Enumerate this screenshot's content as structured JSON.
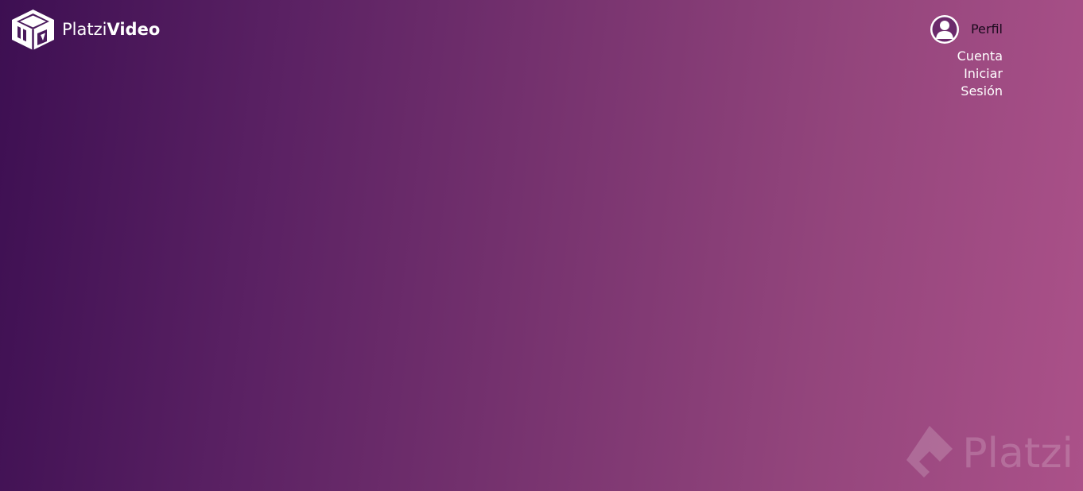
{
  "app": {
    "brand_light": "Platzi",
    "brand_bold": "Video",
    "logo_icon": "platzi-video-cube-icon"
  },
  "user_menu": {
    "avatar_icon": "user-avatar-icon",
    "profile_label": "Perfil",
    "items": [
      {
        "label": "Cuenta"
      },
      {
        "label": "Iniciar Sesión"
      }
    ]
  },
  "watermark": {
    "icon": "platzi-logo-icon",
    "text": "Platzi"
  },
  "colors": {
    "gradient_start": "#3d0f52",
    "gradient_end": "#ab5189",
    "text_primary": "#ffffff",
    "profile_text": "#1b0a1e"
  }
}
